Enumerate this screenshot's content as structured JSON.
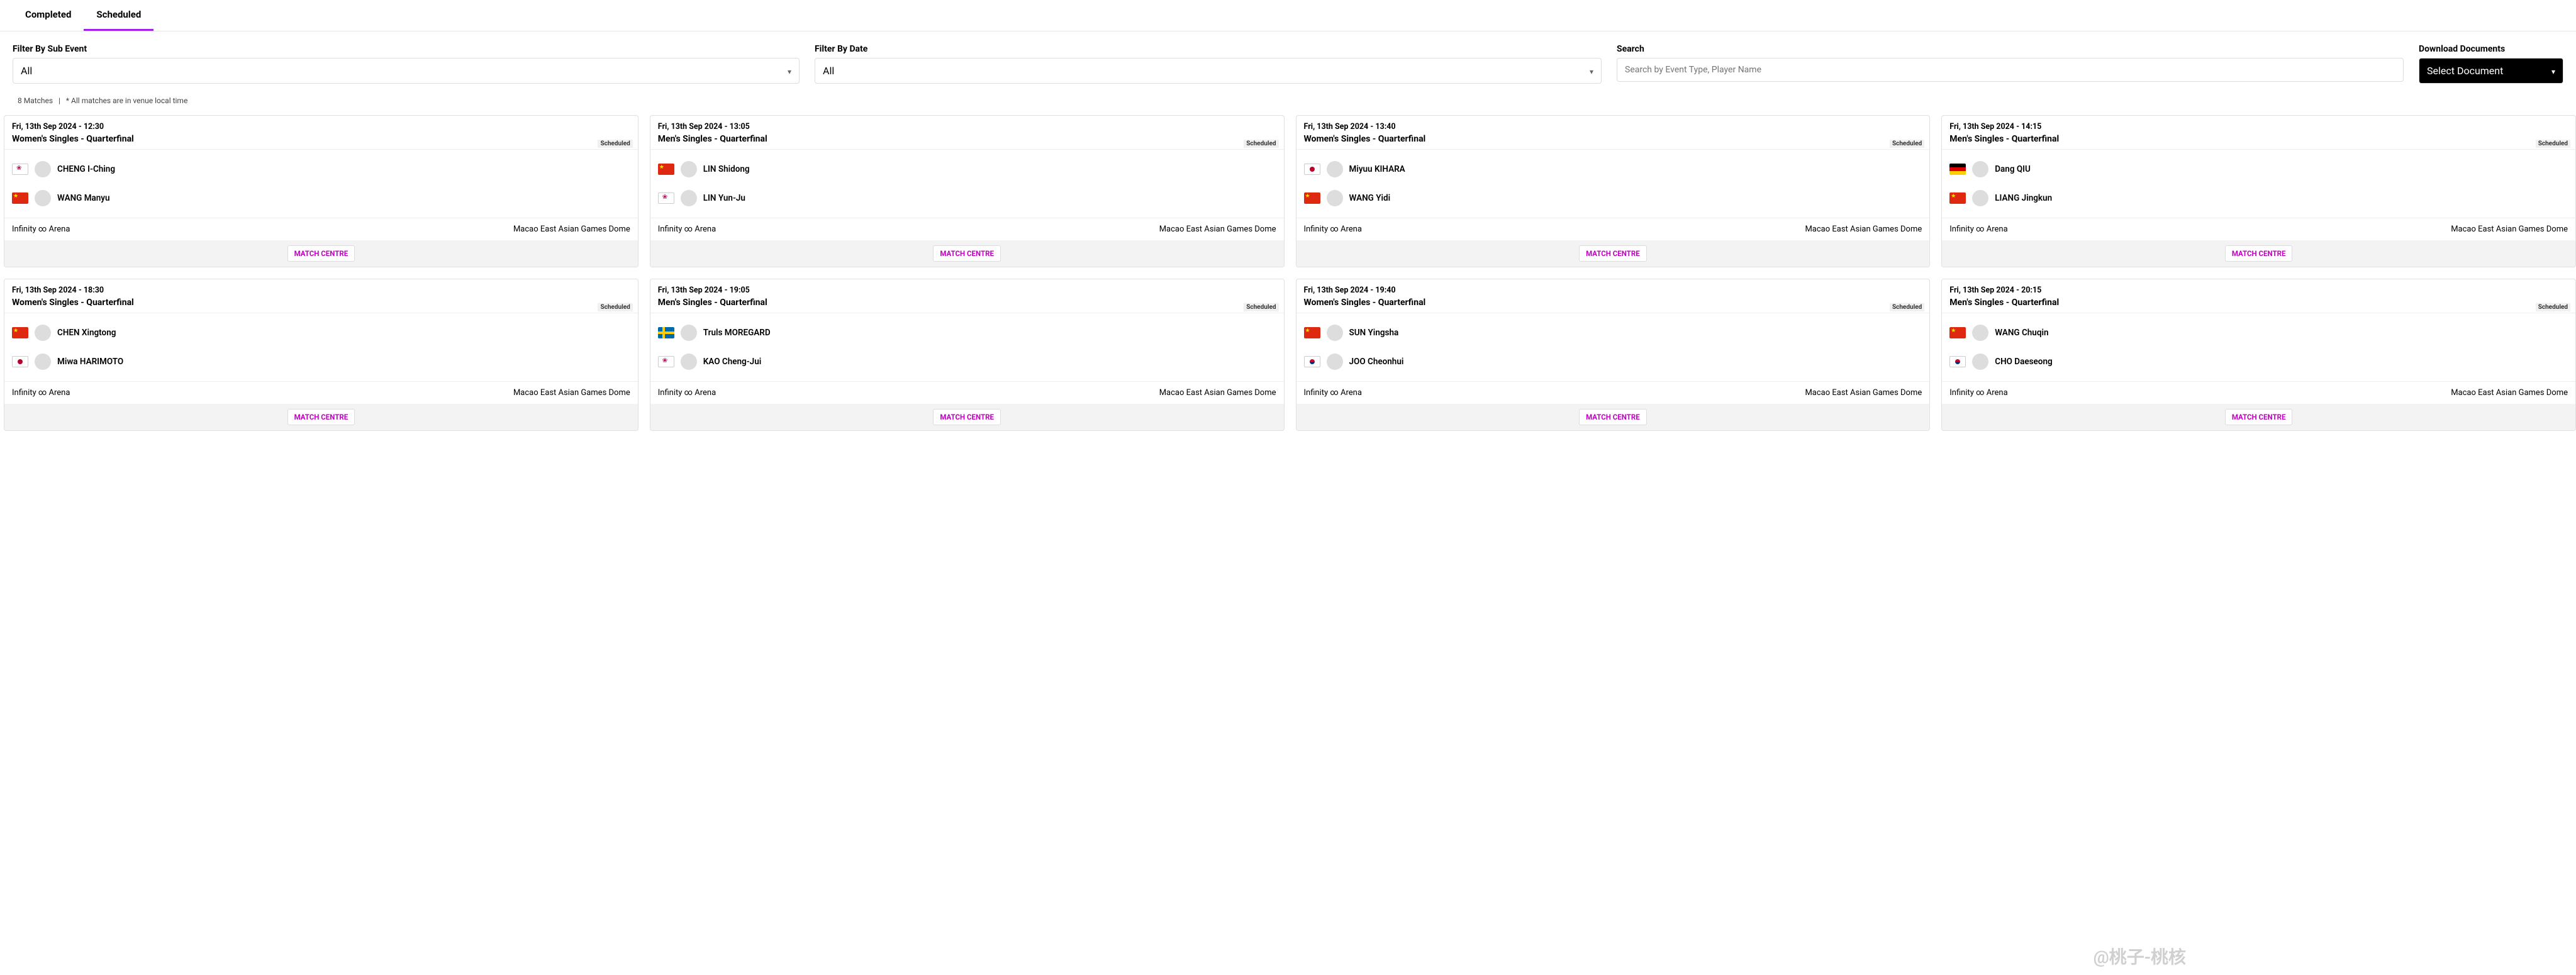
{
  "tabs": {
    "completed": "Completed",
    "scheduled": "Scheduled"
  },
  "filters": {
    "sub_event": {
      "label": "Filter By Sub Event",
      "value": "All"
    },
    "date": {
      "label": "Filter By Date",
      "value": "All"
    },
    "search": {
      "label": "Search",
      "placeholder": "Search by Event Type, Player Name"
    },
    "documents": {
      "label": "Download Documents",
      "value": "Select Document"
    }
  },
  "meta": {
    "count_text": "8 Matches",
    "tz_note": "* All matches are in venue local time"
  },
  "shared": {
    "status": "Scheduled",
    "arena": "Infinity ∞ Arena",
    "dome": "Macao East Asian Games Dome",
    "match_centre": "MATCH CENTRE"
  },
  "matches": [
    {
      "dt": "Fri, 13th Sep 2024 - 12:30",
      "event": "Women's Singles - Quarterfinal",
      "p1": {
        "flag": "tpe",
        "name": "CHENG I-Ching"
      },
      "p2": {
        "flag": "cn",
        "name": "WANG Manyu"
      }
    },
    {
      "dt": "Fri, 13th Sep 2024 - 13:05",
      "event": "Men's Singles - Quarterfinal",
      "p1": {
        "flag": "cn",
        "name": "LIN Shidong"
      },
      "p2": {
        "flag": "tpe",
        "name": "LIN Yun-Ju"
      }
    },
    {
      "dt": "Fri, 13th Sep 2024 - 13:40",
      "event": "Women's Singles - Quarterfinal",
      "p1": {
        "flag": "jp",
        "name": "Miyuu KIHARA"
      },
      "p2": {
        "flag": "cn",
        "name": "WANG Yidi"
      }
    },
    {
      "dt": "Fri, 13th Sep 2024 - 14:15",
      "event": "Men's Singles - Quarterfinal",
      "p1": {
        "flag": "de",
        "name": "Dang QIU"
      },
      "p2": {
        "flag": "cn",
        "name": "LIANG Jingkun"
      }
    },
    {
      "dt": "Fri, 13th Sep 2024 - 18:30",
      "event": "Women's Singles - Quarterfinal",
      "p1": {
        "flag": "cn",
        "name": "CHEN Xingtong"
      },
      "p2": {
        "flag": "jp",
        "name": "Miwa HARIMOTO"
      }
    },
    {
      "dt": "Fri, 13th Sep 2024 - 19:05",
      "event": "Men's Singles - Quarterfinal",
      "p1": {
        "flag": "se",
        "name": "Truls MOREGARD"
      },
      "p2": {
        "flag": "tpe",
        "name": "KAO Cheng-Jui"
      }
    },
    {
      "dt": "Fri, 13th Sep 2024 - 19:40",
      "event": "Women's Singles - Quarterfinal",
      "p1": {
        "flag": "cn",
        "name": "SUN Yingsha"
      },
      "p2": {
        "flag": "kr",
        "name": "JOO Cheonhui"
      }
    },
    {
      "dt": "Fri, 13th Sep 2024 - 20:15",
      "event": "Men's Singles - Quarterfinal",
      "p1": {
        "flag": "cn",
        "name": "WANG Chuqin"
      },
      "p2": {
        "flag": "kr",
        "name": "CHO Daeseong"
      }
    }
  ],
  "watermark": "@桃子-桃核"
}
